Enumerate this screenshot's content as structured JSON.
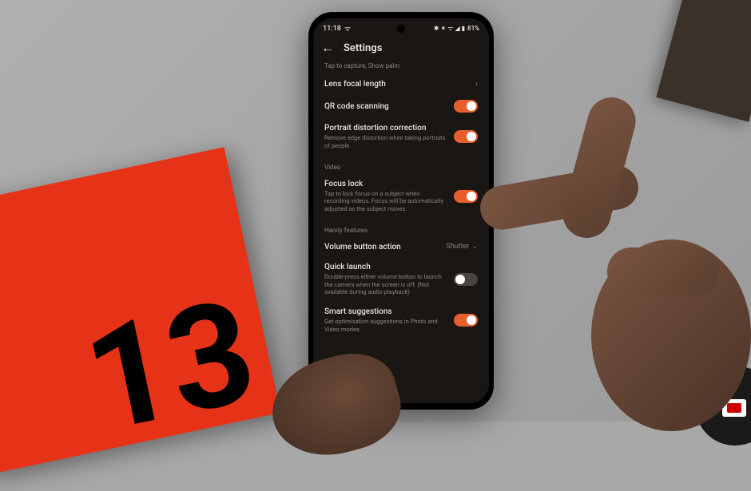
{
  "status": {
    "time": "11:18",
    "icons": "ᯤ",
    "right_icons": "✱ ⁕ ᯤ ◢ ▮",
    "battery": "81%"
  },
  "header": {
    "title": "Settings"
  },
  "hint": "Tap to capture, Show palm",
  "settings": {
    "lens_focal": {
      "title": "Lens focal length"
    },
    "qr": {
      "title": "QR code scanning"
    },
    "portrait": {
      "title": "Portrait distortion correction",
      "desc": "Remove edge distortion when taking portraits of people."
    },
    "video_section": "Video",
    "focus_lock": {
      "title": "Focus lock",
      "desc": "Tap to lock focus on a subject when recording videos. Focus will be automatically adjusted as the subject moves."
    },
    "handy_section": "Handy features",
    "volume": {
      "title": "Volume button action",
      "value": "Shutter"
    },
    "quick_launch": {
      "title": "Quick launch",
      "desc": "Double-press either volume button to launch the camera when the screen is off. (Not available during audio playback)"
    },
    "smart": {
      "title": "Smart suggestions",
      "desc": "Get optimisation suggestions in Photo and Video modes."
    }
  },
  "box_number": "13"
}
